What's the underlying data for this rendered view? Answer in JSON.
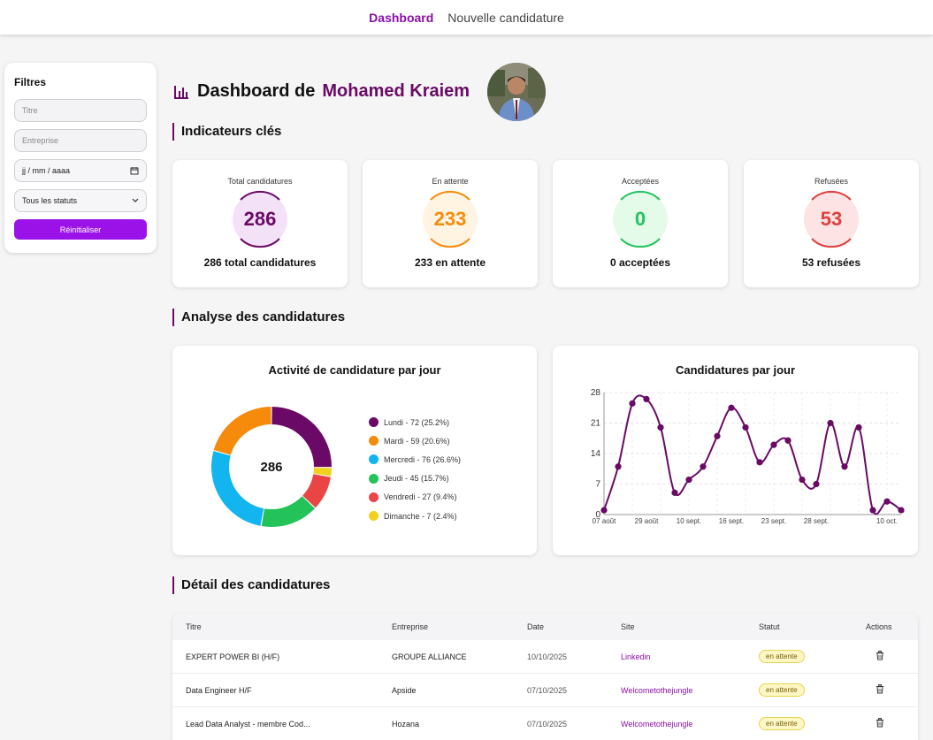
{
  "nav": {
    "active": "Dashboard",
    "link": "Nouvelle candidature"
  },
  "filters": {
    "title": "Filtres",
    "titre_placeholder": "Titre",
    "entreprise_placeholder": "Entreprise",
    "date_placeholder": "jj / mm / aaaa",
    "status_value": "Tous les statuts",
    "reset_label": "Réinitialiser"
  },
  "header": {
    "prefix": "Dashboard de",
    "name": "Mohamed Kraiem"
  },
  "sections": {
    "kpi": "Indicateurs clés",
    "analysis": "Analyse des candidatures",
    "detail": "Détail des candidatures"
  },
  "kpis": [
    {
      "label": "Total candidatures",
      "value": "286",
      "caption": "286 total candidatures",
      "color": "#6a0a66",
      "bg": "#f3e2f7"
    },
    {
      "label": "En attente",
      "value": "233",
      "caption": "233 en attente",
      "color": "#f68a0a",
      "bg": "#fff4e2"
    },
    {
      "label": "Acceptées",
      "value": "0",
      "caption": "0 acceptées",
      "color": "#22c55e",
      "bg": "#e3fbe8"
    },
    {
      "label": "Refusées",
      "value": "53",
      "caption": "53 refusées",
      "color": "#e03e3e",
      "bg": "#fde3e3"
    }
  ],
  "chart_data": [
    {
      "type": "pie",
      "title": "Activité de candidature par jour",
      "center_label": "286",
      "slices": [
        {
          "label": "Lundi - 72 (25.2%)",
          "value": 72,
          "color": "#6a0a66"
        },
        {
          "label": "Dimanche - 7 (2.4%)",
          "value": 7,
          "color": "#f0d21e"
        },
        {
          "label": "Vendredi - 27 (9.4%)",
          "value": 27,
          "color": "#ea4545"
        },
        {
          "label": "Jeudi - 45 (15.7%)",
          "value": 45,
          "color": "#23c35a"
        },
        {
          "label": "Mercredi - 76 (26.6%)",
          "value": 76,
          "color": "#12b5f0"
        },
        {
          "label": "Mardi - 59 (20.6%)",
          "value": 59,
          "color": "#f68a0a"
        }
      ],
      "legend_order": [
        {
          "label": "Lundi - 72 (25.2%)",
          "color": "#6a0a66"
        },
        {
          "label": "Mardi - 59 (20.6%)",
          "color": "#f68a0a"
        },
        {
          "label": "Mercredi - 76 (26.6%)",
          "color": "#12b5f0"
        },
        {
          "label": "Jeudi - 45 (15.7%)",
          "color": "#23c35a"
        },
        {
          "label": "Vendredi - 27 (9.4%)",
          "color": "#ea4545"
        },
        {
          "label": "Dimanche - 7 (2.4%)",
          "color": "#f0d21e"
        }
      ]
    },
    {
      "type": "line",
      "title": "Candidatures par jour",
      "color": "#6a0a66",
      "ylim": [
        0,
        28
      ],
      "yticks": [
        0,
        7,
        14,
        21,
        28
      ],
      "xticks": [
        "07 août",
        "29 août",
        "10 sept.",
        "16 sept.",
        "23 sept.",
        "28 sept.",
        "10 oct."
      ],
      "xtick_index": [
        0,
        3,
        6,
        9,
        12,
        15,
        20
      ],
      "values": [
        1,
        11,
        25.5,
        26.5,
        20,
        5,
        8,
        11,
        18,
        24.5,
        20,
        12,
        16,
        17,
        8,
        7,
        21,
        11,
        20,
        1,
        3,
        1
      ],
      "grid": true
    }
  ],
  "table": {
    "headers": [
      "Titre",
      "Entreprise",
      "Date",
      "Site",
      "Statut",
      "Actions"
    ],
    "rows": [
      {
        "titre": "EXPERT POWER BI (H/F)",
        "entreprise": "GROUPE ALLIANCE",
        "date": "10/10/2025",
        "site": "Linkedin",
        "statut": "en attente"
      },
      {
        "titre": "Data Engineer H/F",
        "entreprise": "Apside",
        "date": "07/10/2025",
        "site": "Welcometothejungle",
        "statut": "en attente"
      },
      {
        "titre": "Lead Data Analyst - membre Cod...",
        "entreprise": "Hozana",
        "date": "07/10/2025",
        "site": "Welcometothejungle",
        "statut": "en attente"
      }
    ]
  }
}
